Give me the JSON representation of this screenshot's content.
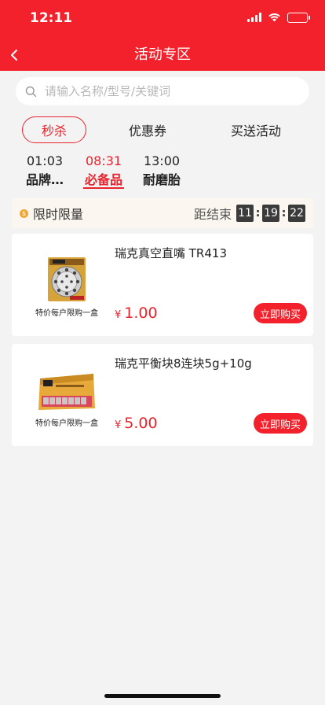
{
  "status_bar": {
    "time": "12:11"
  },
  "nav": {
    "title": "活动专区"
  },
  "search": {
    "placeholder": "请输入名称/型号/关键词"
  },
  "tabs": [
    {
      "label": "秒杀",
      "active": true
    },
    {
      "label": "优惠券",
      "active": false
    },
    {
      "label": "买送活动",
      "active": false
    }
  ],
  "time_slots": [
    {
      "time": "01:03",
      "label": "品牌…",
      "active": false
    },
    {
      "time": "08:31",
      "label": "必备品",
      "active": true
    },
    {
      "time": "13:00",
      "label": "耐磨胎",
      "active": false
    }
  ],
  "banner": {
    "title": "限时限量",
    "ends_label": "距结束",
    "countdown": {
      "hours": "11",
      "minutes": "19",
      "seconds": "22"
    }
  },
  "products": [
    {
      "name": "瑞克真空直嘴 TR413",
      "caption": "特价每户限购一盒",
      "currency": "¥",
      "price": "1.00",
      "buy_label": "立即购买"
    },
    {
      "name": "瑞克平衡块8连块5g+10g",
      "caption": "特价每户限购一盒",
      "currency": "¥",
      "price": "5.00",
      "buy_label": "立即购买"
    }
  ],
  "colors": {
    "primary_red": "#f3212b",
    "banner_bg": "#fbf6ef",
    "page_bg": "#f3f3f3"
  }
}
